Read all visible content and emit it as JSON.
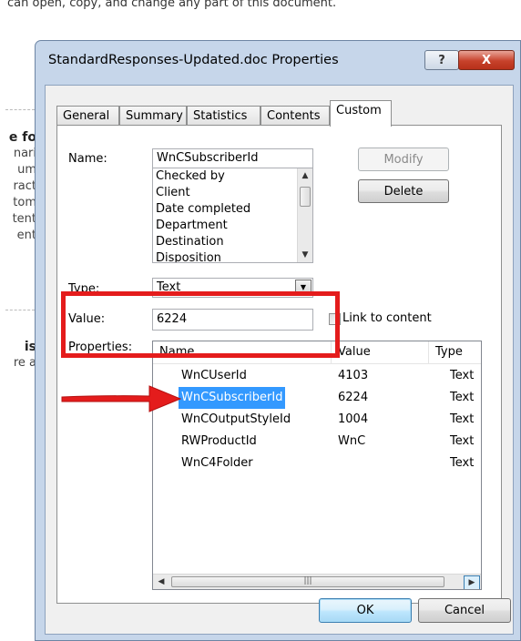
{
  "background": {
    "top_text": "can open, copy, and change any part of this document.",
    "fragments": [
      "e fo",
      "nari",
      "um",
      "ract",
      "tom",
      "tent",
      "ent"
    ],
    "fragments2": [
      "is",
      "re a"
    ]
  },
  "dialog": {
    "title": "StandardResponses-Updated.doc Properties",
    "help_glyph": "?",
    "close_glyph": "X",
    "tabs": [
      "General",
      "Summary",
      "Statistics",
      "Contents",
      "Custom"
    ],
    "active_tab": "Custom",
    "name_label": "Name:",
    "name_value": "WnCSubscriberId",
    "name_list": [
      "Checked by",
      "Client",
      "Date completed",
      "Department",
      "Destination",
      "Disposition"
    ],
    "modify_label": "Modify",
    "delete_label": "Delete",
    "type_label": "Type:",
    "type_value": "Text",
    "value_label": "Value:",
    "value_value": "6224",
    "link_label": "Link to content",
    "properties_label": "Properties:",
    "columns": [
      "Name",
      "Value",
      "Type"
    ],
    "rows": [
      {
        "name": "WnCUserId",
        "value": "4103",
        "type": "Text"
      },
      {
        "name": "WnCSubscriberId",
        "value": "6224",
        "type": "Text"
      },
      {
        "name": "WnCOutputStyleId",
        "value": "1004",
        "type": "Text"
      },
      {
        "name": "RWProductId",
        "value": "WnC",
        "type": "Text"
      },
      {
        "name": "WnC4Folder",
        "value": "",
        "type": "Text"
      }
    ],
    "selected_row": "WnCSubscriberId",
    "ok_label": "OK",
    "cancel_label": "Cancel"
  },
  "colors": {
    "annotation": "#e41c1c",
    "selection": "#3399ff",
    "frame": "#c6d6ea"
  },
  "icons": {
    "annotation_arrow": "red-arrow-icon"
  }
}
